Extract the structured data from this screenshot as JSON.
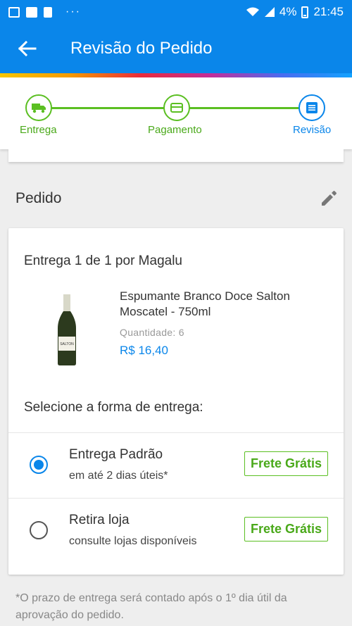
{
  "status_bar": {
    "dots": "···",
    "battery": "4%",
    "time": "21:45"
  },
  "app_bar": {
    "back_icon": "arrow-left-icon",
    "title": "Revisão do Pedido"
  },
  "stepper": {
    "steps": [
      {
        "label": "Entrega",
        "icon": "truck-icon",
        "state": "done"
      },
      {
        "label": "Pagamento",
        "icon": "credit-card-icon",
        "state": "done"
      },
      {
        "label": "Revisão",
        "icon": "list-icon",
        "state": "active"
      }
    ]
  },
  "order": {
    "title": "Pedido",
    "delivery_heading": "Entrega 1 de 1 por Magalu",
    "product": {
      "name": "Espumante Branco Doce Salton Moscatel - 750ml",
      "quantity_label": "Quantidade:",
      "quantity": "6",
      "price": "R$ 16,40",
      "image_label": "SALTON"
    },
    "shipping_title": "Selecione a forma de entrega:",
    "options": [
      {
        "title": "Entrega Padrão",
        "subtitle": "em até 2 dias úteis*",
        "badge": "Frete Grátis",
        "selected": true
      },
      {
        "title": "Retira loja",
        "subtitle": "consulte lojas disponíveis",
        "badge": "Frete Grátis",
        "selected": false
      }
    ]
  },
  "footnote": "*O prazo de entrega será contado após o 1º dia útil da aprovação do pedido.",
  "colors": {
    "primary": "#0a86ea",
    "success": "#5bbf22"
  }
}
